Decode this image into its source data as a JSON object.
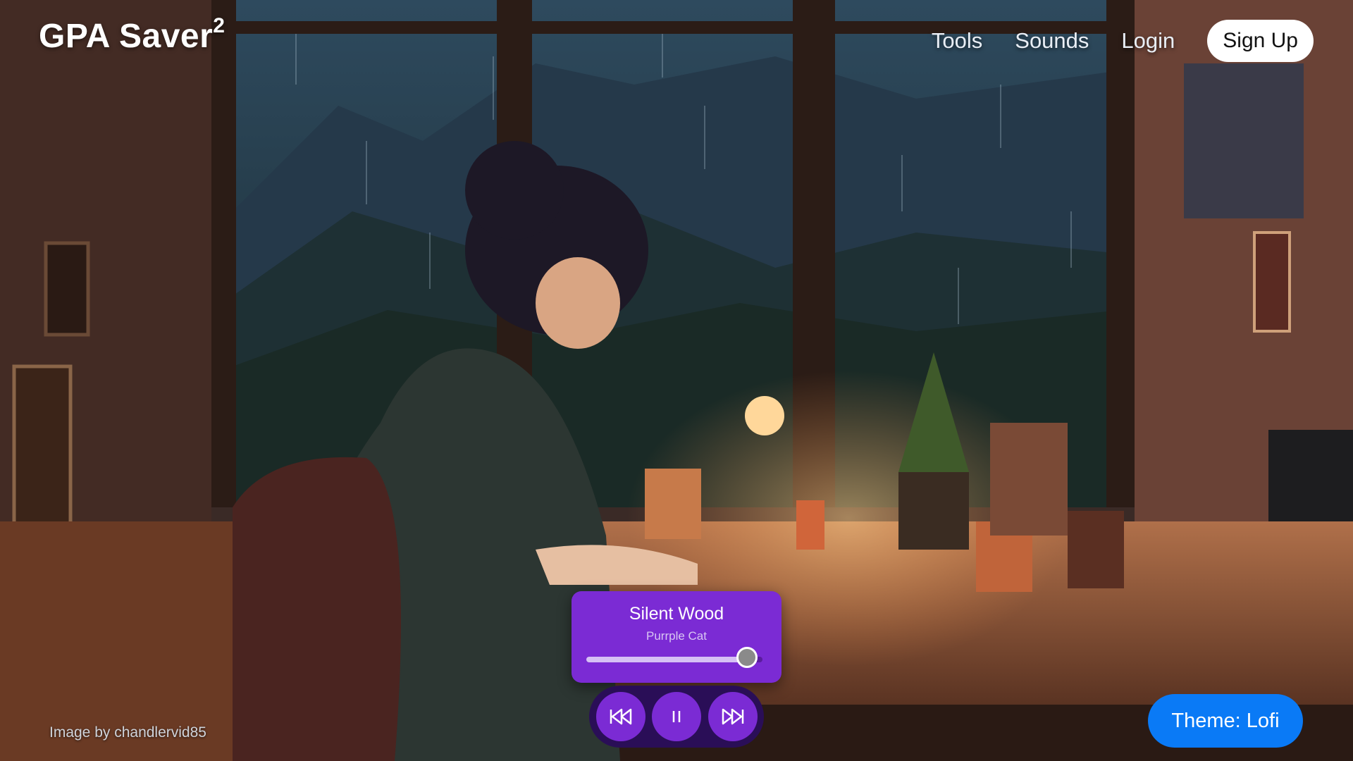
{
  "brand": {
    "name": "GPA Saver",
    "superscript": "2"
  },
  "nav": {
    "tools": "Tools",
    "sounds": "Sounds",
    "login": "Login",
    "signup": "Sign Up"
  },
  "player": {
    "title": "Silent Wood",
    "artist": "Purrple Cat",
    "progress": 0.91,
    "controls": {
      "prev_icon": "skip-back-icon",
      "pause_icon": "pause-icon",
      "next_icon": "skip-forward-icon"
    }
  },
  "credit": "Image by chandlervid85",
  "theme": {
    "label": "Theme: Lofi"
  },
  "colors": {
    "accent": "#7b2bd4",
    "player_bar": "#2a0e57",
    "theme_button": "#0a7af6"
  }
}
